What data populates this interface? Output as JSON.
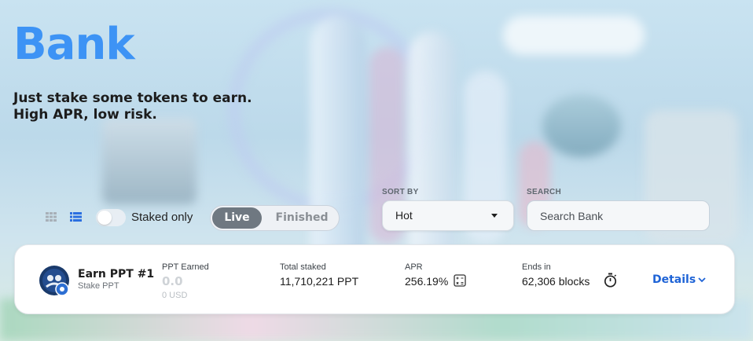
{
  "header": {
    "title": "Bank",
    "subtitle_line1": "Just stake some tokens to earn.",
    "subtitle_line2": "High APR, low risk."
  },
  "controls": {
    "view_grid_icon": "grid-view-icon",
    "view_list_icon": "list-view-icon",
    "staked_only_label": "Staked only",
    "staked_only_on": false,
    "tabs": [
      "Live",
      "Finished"
    ],
    "active_tab": "Live",
    "sort_label": "SORT BY",
    "sort_value": "Hot",
    "search_label": "SEARCH",
    "search_placeholder": "Search Bank",
    "search_value": ""
  },
  "pool": {
    "name": "Earn PPT #1",
    "sub": "Stake PPT",
    "earned_label": "PPT Earned",
    "earned_value": "0.0",
    "earned_usd": "0 USD",
    "total_label": "Total staked",
    "total_value": "11,710,221 PPT",
    "apr_label": "APR",
    "apr_value": "256.19%",
    "ends_label": "Ends in",
    "ends_value": "62,306 blocks",
    "details_label": "Details"
  },
  "colors": {
    "accent": "#3d93f5",
    "link": "#1e63d6",
    "active_tab_bg": "#6f7881"
  }
}
